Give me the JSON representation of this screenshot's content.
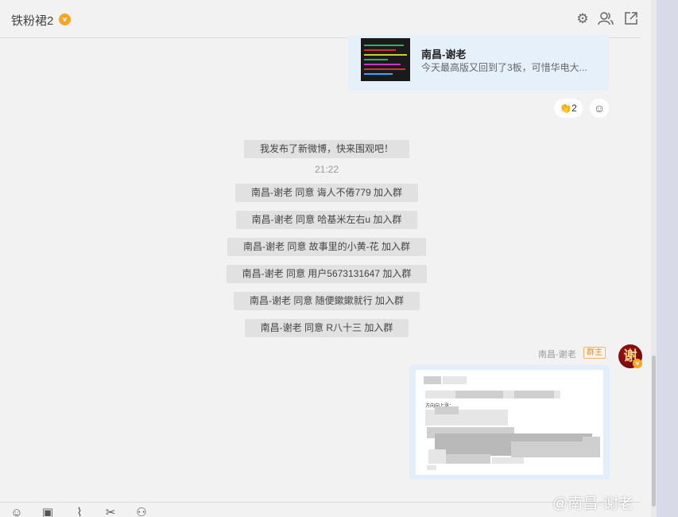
{
  "header": {
    "group_name": "铁粉裙2",
    "verified_badge": "v",
    "icons": [
      "settings-icon",
      "members-icon",
      "popout-icon"
    ]
  },
  "link_card": {
    "title": "南昌-谢老",
    "description": "今天最高版又回到了3板，可惜华电大..."
  },
  "reaction": {
    "emoji": "👏",
    "count": "2",
    "add_icon": "smile-plus-icon"
  },
  "notices": {
    "weibo_post": "我发布了新微博，快来围观吧！",
    "time": "21:22",
    "joins": [
      "南昌-谢老 同意 诲人不倦779 加入群",
      "南昌-谢老 同意 哈基米左右u 加入群",
      "南昌-谢老 同意 故事里的小黄-花 加入群",
      "南昌-谢老 同意 用户5673131647 加入群",
      "南昌-谢老 同意 随便鏉鏉就行 加入群",
      "南昌-谢老 同意 R八十三 加入群"
    ]
  },
  "sender": {
    "name": "南昌-谢老",
    "role": "群主",
    "avatar_text": "谢",
    "avatar_badge": "v"
  },
  "image_message": {
    "visible_text": "方向向上涨："
  },
  "toolbar": {
    "icons": [
      "emoji-icon",
      "image-icon",
      "attachment-icon",
      "scissors-icon",
      "more-icon"
    ]
  },
  "watermark": "@南昌-谢老",
  "colors": {
    "window_bg": "#f2f2f2",
    "notice_bg": "#e1e1e1",
    "bubble_bg": "#e3eefb",
    "accent_orange": "#f5a623",
    "side_strip": "#d9dae8"
  }
}
